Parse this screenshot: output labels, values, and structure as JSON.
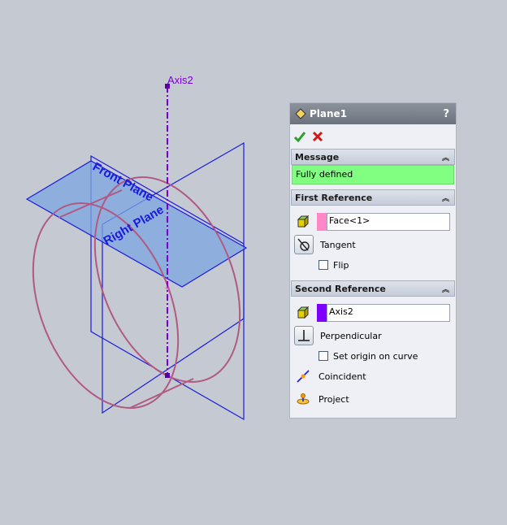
{
  "viewport": {
    "axis_label": "Axis2",
    "front_plane_label": "Front Plane",
    "right_plane_label": "Right Plane",
    "colors": {
      "axis": "#7a00d6",
      "plane_edge": "#1b1bdc",
      "plane_fill": "#7ba6e0",
      "sketch": "#b05a82"
    }
  },
  "panel": {
    "title": "Plane1",
    "help": "?",
    "ok_icon": "checkmark-icon",
    "cancel_icon": "cross-icon",
    "message": {
      "header": "Message",
      "text": "Fully defined",
      "bg": "#80ff80"
    },
    "first_reference": {
      "header": "First Reference",
      "selection": "Face<1>",
      "swatch_color": "#ff88c8",
      "option": "Tangent",
      "flip_label": "Flip",
      "flip_checked": false
    },
    "second_reference": {
      "header": "Second Reference",
      "selection": "Axis2",
      "swatch_color": "#8000ff",
      "options": [
        "Perpendicular",
        "Coincident",
        "Project"
      ],
      "set_origin_label": "Set origin on curve",
      "set_origin_checked": false
    }
  }
}
